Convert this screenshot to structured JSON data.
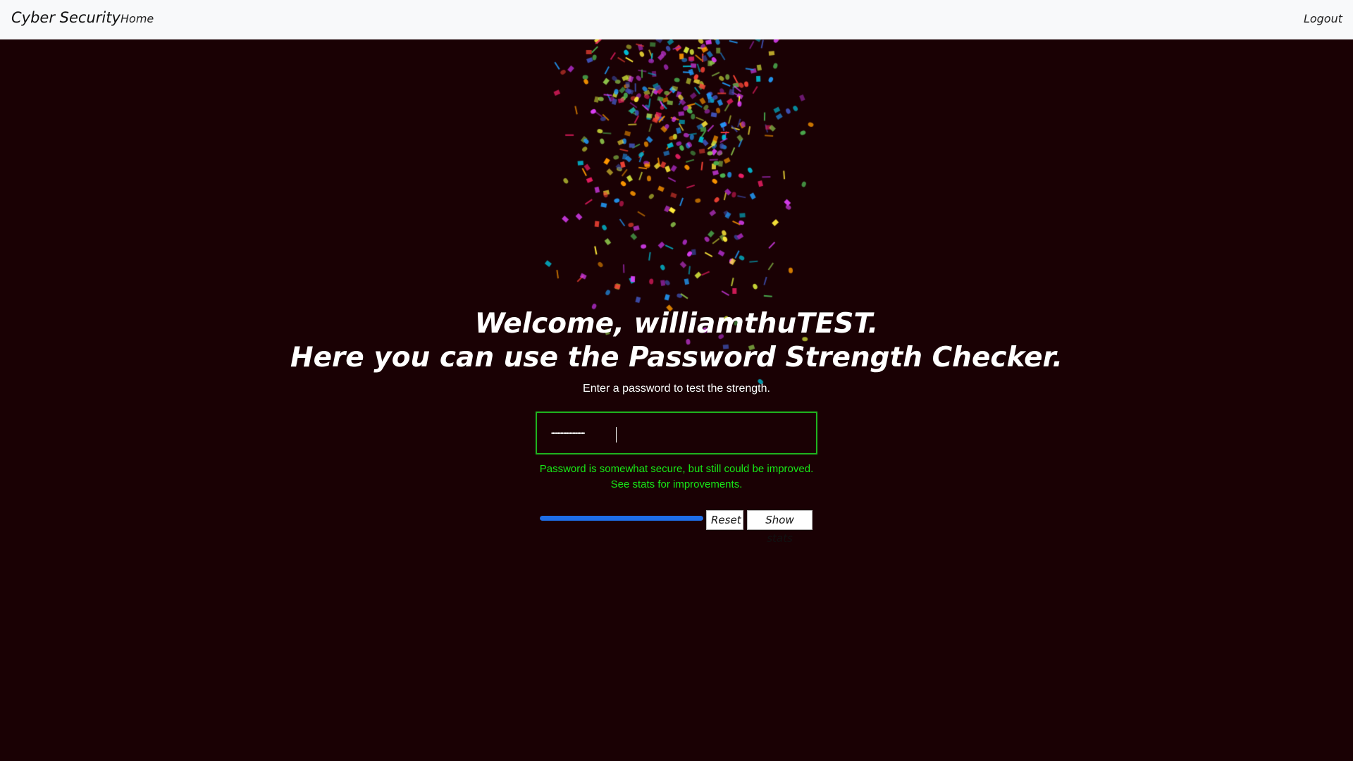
{
  "navbar": {
    "brand": "Cyber Security",
    "home_label": "Home",
    "logout_label": "Logout"
  },
  "main": {
    "welcome_line": "Welcome, williamthuTEST.",
    "checker_line": "Here you can use the Password Strength Checker.",
    "instruction": "Enter a password to test the strength."
  },
  "password_field": {
    "value": "••••••••••••••••••••••"
  },
  "result": {
    "line1": "Password is somewhat secure, but still could be improved.",
    "line2": "See stats for improvements."
  },
  "strength": {
    "level_percent": 100,
    "color": "#1e6ee8"
  },
  "buttons": {
    "reset_label": "Reset",
    "stats_label": "Show stats"
  },
  "colors": {
    "background": "#1a0104",
    "navbar": "#f8f9fa",
    "input_border": "#1fb31f",
    "message_text": "#17e817"
  }
}
